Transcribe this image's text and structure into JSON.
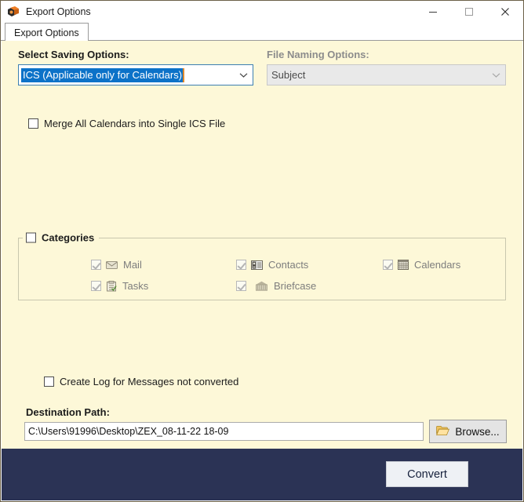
{
  "window": {
    "title": "Export Options",
    "icon": "app-icon",
    "controls": {
      "minimize": "minimize-icon",
      "maximize": "maximize-icon",
      "close": "close-icon"
    }
  },
  "tabs": [
    {
      "label": "Export Options",
      "active": true
    }
  ],
  "saving": {
    "label": "Select Saving Options:",
    "selected": "ICS (Applicable only for Calendars)"
  },
  "file_naming": {
    "label": "File Naming Options:",
    "selected": "Subject",
    "disabled": true
  },
  "merge": {
    "label": "Merge All Calendars into Single ICS File",
    "checked": false
  },
  "categories": {
    "title": "Categories",
    "checked": false,
    "items": [
      {
        "label": "Mail",
        "icon": "envelope-icon",
        "checked": true,
        "disabled": true
      },
      {
        "label": "Tasks",
        "icon": "clipboard-icon",
        "checked": true,
        "disabled": true
      },
      {
        "label": "Contacts",
        "icon": "contact-card-icon",
        "checked": true,
        "disabled": true
      },
      {
        "label": "Briefcase",
        "icon": "briefcase-icon",
        "checked": true,
        "disabled": true
      },
      {
        "label": "Calendars",
        "icon": "calendar-icon",
        "checked": true,
        "disabled": true
      }
    ]
  },
  "create_log": {
    "label": "Create Log for Messages not converted",
    "checked": false
  },
  "destination": {
    "label": "Destination Path:",
    "path": "C:\\Users\\91996\\Desktop\\ZEX_08-11-22 18-09",
    "browse_label": "Browse...",
    "browse_icon": "open-folder-icon"
  },
  "actions": {
    "convert_label": "Convert"
  },
  "colors": {
    "client_background": "#fdf8d8",
    "bottom_bar": "#2b3355",
    "selection_blue": "#0c72c8",
    "accent_orange": "#e08a2e"
  }
}
